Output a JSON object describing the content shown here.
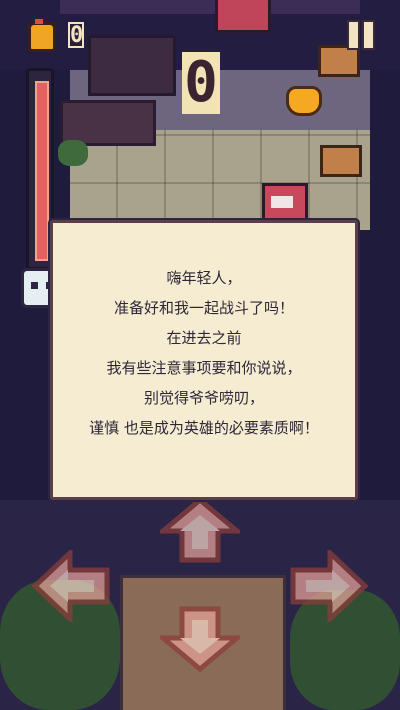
{
  "hud": {
    "coin_count": "0",
    "score": "0"
  },
  "dialog": {
    "lines": [
      "嗨年轻人，",
      "准备好和我一起战斗了吗！",
      "在进去之前",
      "我有些注意事项要和你说说，",
      "别觉得爷爷唠叨，",
      "谨慎 也是成为英雄的必要素质啊！"
    ]
  },
  "controls": {
    "up": "up-arrow",
    "down": "down-arrow",
    "left": "left-arrow",
    "right": "right-arrow"
  },
  "colors": {
    "background": "#1f1b3c",
    "dialog_bg": "#f5ecd1",
    "health": "#e4615f",
    "arrow": "#e9a39a",
    "score_bg": "#f1e3b3"
  },
  "health_fraction": 1.0
}
